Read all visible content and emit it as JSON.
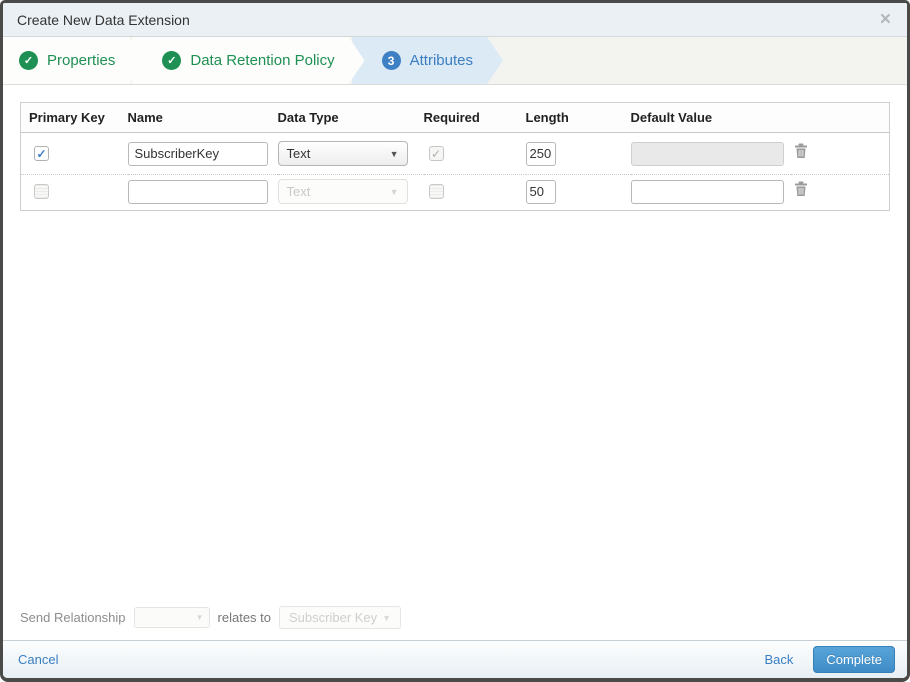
{
  "modal": {
    "title": "Create New Data Extension",
    "close_glyph": "×"
  },
  "wizard": {
    "steps": [
      {
        "label": "Properties",
        "status": "complete"
      },
      {
        "label": "Data Retention Policy",
        "status": "complete"
      },
      {
        "label": "Attributes",
        "status": "active",
        "number": "3"
      }
    ]
  },
  "icons": {
    "check": "✓",
    "caret_down": "▼"
  },
  "table": {
    "headers": {
      "primary_key": "Primary Key",
      "name": "Name",
      "data_type": "Data Type",
      "required": "Required",
      "length": "Length",
      "default_value": "Default Value"
    },
    "rows": [
      {
        "primary_key_checked": true,
        "name": "SubscriberKey",
        "data_type": "Text",
        "data_type_disabled": false,
        "required_checked": true,
        "required_disabled": true,
        "length": "250",
        "default_value": "",
        "default_disabled": true
      },
      {
        "primary_key_checked": false,
        "name": "",
        "data_type": "Text",
        "data_type_disabled": true,
        "required_checked": false,
        "required_disabled": false,
        "length": "50",
        "default_value": "",
        "default_disabled": false
      }
    ]
  },
  "send_relationship": {
    "label": "Send Relationship",
    "relates_to": "relates to",
    "target_field": "Subscriber Key"
  },
  "footer": {
    "cancel": "Cancel",
    "back": "Back",
    "complete": "Complete"
  },
  "colors": {
    "step_green": "#1e9053",
    "step_blue": "#3d80c4",
    "active_step_bg": "#dceaf5",
    "link_blue": "#3b7ec2",
    "complete_button": "#3e8cc7"
  }
}
